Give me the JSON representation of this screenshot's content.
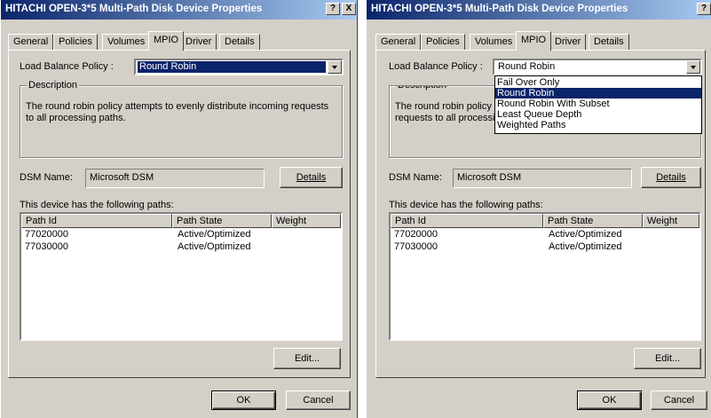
{
  "window": {
    "title": "HITACHI OPEN-3*5 Multi-Path Disk Device Properties",
    "help_label": "?",
    "close_label": "X"
  },
  "tabs": [
    {
      "label": "General"
    },
    {
      "label": "Policies"
    },
    {
      "label": "Volumes"
    },
    {
      "label": "MPIO"
    },
    {
      "label": "Driver"
    },
    {
      "label": "Details"
    }
  ],
  "active_tab": "MPIO",
  "policy": {
    "label": "Load Balance Policy :",
    "value": "Round Robin",
    "options": [
      "Fail Over Only",
      "Round Robin",
      "Round Robin With Subset",
      "Least Queue Depth",
      "Weighted Paths"
    ],
    "highlighted_option": "Round Robin"
  },
  "description": {
    "label": "Description",
    "text": "The round robin policy attempts to evenly distribute incoming requests to all processing paths."
  },
  "dsm": {
    "label": "DSM Name:",
    "value": "Microsoft DSM",
    "details_button": "Details"
  },
  "paths": {
    "label": "This device has the following paths:",
    "columns": [
      "Path Id",
      "Path State",
      "Weight"
    ],
    "rows": [
      {
        "path_id": "77020000",
        "state": "Active/Optimized",
        "weight": ""
      },
      {
        "path_id": "77030000",
        "state": "Active/Optimized",
        "weight": ""
      }
    ],
    "edit_button": "Edit..."
  },
  "footer": {
    "ok": "OK",
    "cancel": "Cancel"
  },
  "colors": {
    "title_start": "#0a246a",
    "title_end": "#a6caf0",
    "face": "#d4d0c8",
    "selection": "#0a246a"
  }
}
